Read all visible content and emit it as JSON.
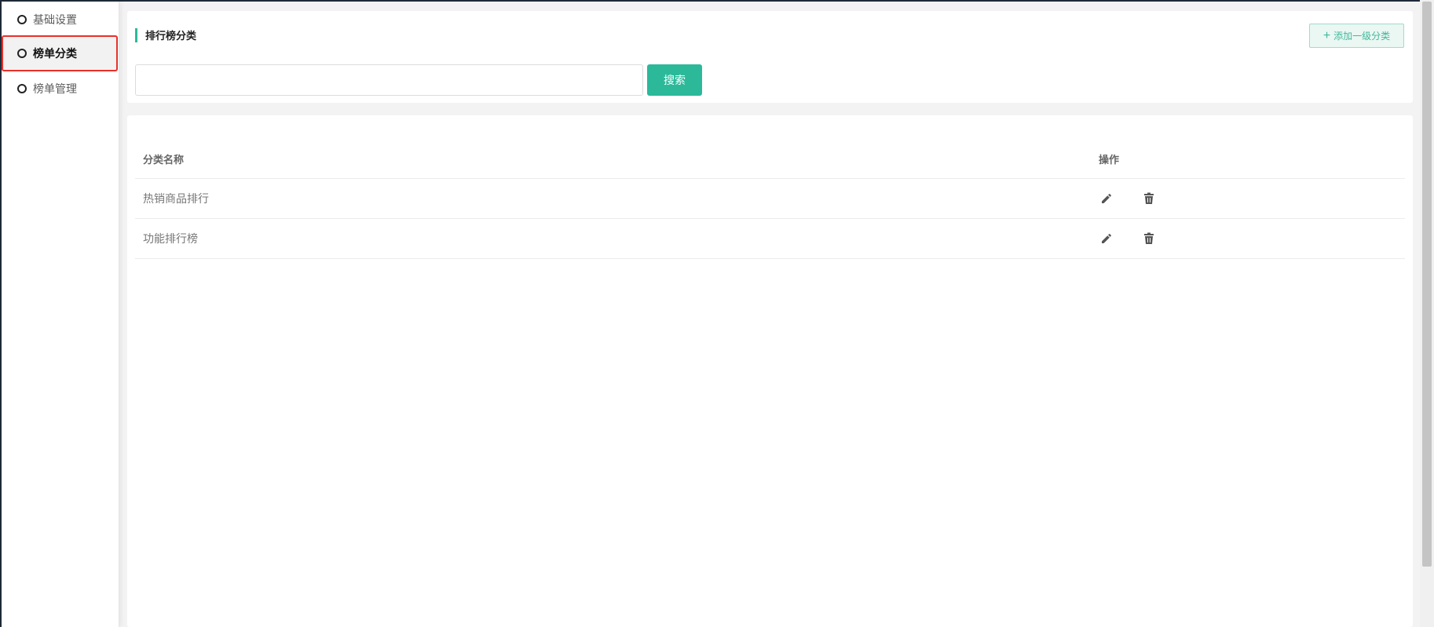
{
  "sidebar": {
    "items": [
      {
        "label": "基础设置",
        "active": false
      },
      {
        "label": "榜单分类",
        "active": true
      },
      {
        "label": "榜单管理",
        "active": false
      }
    ]
  },
  "header": {
    "title": "排行榜分类",
    "add_button_label": "添加一级分类",
    "add_icon": "plus-icon"
  },
  "search": {
    "value": "",
    "button_label": "搜索"
  },
  "table": {
    "columns": [
      "分类名称",
      "操作"
    ],
    "rows": [
      {
        "name": "热销商品排行",
        "actions": [
          "edit-icon",
          "delete-icon"
        ]
      },
      {
        "name": "功能排行榜",
        "actions": [
          "edit-icon",
          "delete-icon"
        ]
      }
    ]
  },
  "colors": {
    "accent": "#2bb99a",
    "active_highlight_border": "#e8302a"
  }
}
